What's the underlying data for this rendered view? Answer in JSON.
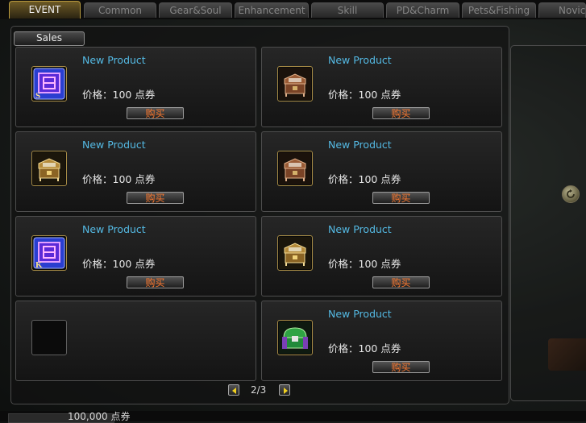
{
  "tabs": [
    {
      "label": "EVENT",
      "active": true
    },
    {
      "label": "Common",
      "active": false
    },
    {
      "label": "Gear&Soul",
      "active": false
    },
    {
      "label": "Enhancement",
      "active": false
    },
    {
      "label": "Skill",
      "active": false
    },
    {
      "label": "PD&Charm",
      "active": false
    },
    {
      "label": "Pets&Fishing",
      "active": false
    },
    {
      "label": "Novic",
      "active": false
    }
  ],
  "sub_tab": "Sales",
  "products": [
    {
      "name": "New Product",
      "price": "价格：100 点券",
      "buy_label": "购买",
      "icon": "blue-book-s-icon"
    },
    {
      "name": "New Product",
      "price": "价格：100 点券",
      "buy_label": "购买",
      "icon": "brown-chest-icon"
    },
    {
      "name": "New Product",
      "price": "价格：100 点券",
      "buy_label": "购买",
      "icon": "gold-chest-icon"
    },
    {
      "name": "New Product",
      "price": "价格：100 点券",
      "buy_label": "购买",
      "icon": "brown-chest-icon"
    },
    {
      "name": "New Product",
      "price": "价格：100 点券",
      "buy_label": "购买",
      "icon": "blue-book-k-icon"
    },
    {
      "name": "New Product",
      "price": "价格：100 点券",
      "buy_label": "购买",
      "icon": "gold-chest-icon"
    },
    {
      "name": "",
      "price": "",
      "buy_label": "",
      "icon": ""
    },
    {
      "name": "New Product",
      "price": "价格：100 点券",
      "buy_label": "购买",
      "icon": "green-chest-icon"
    }
  ],
  "book_letters": {
    "s": "S",
    "k": "K"
  },
  "pagination": {
    "text": "2/3",
    "prev_icon": "arrow-left-icon",
    "next_icon": "arrow-right-icon"
  },
  "balance": "100,000  点券",
  "colors": {
    "product_name": "#54b9e3",
    "buy_label": "#ff7a2f",
    "active_tab_border": "#b89a3e"
  }
}
